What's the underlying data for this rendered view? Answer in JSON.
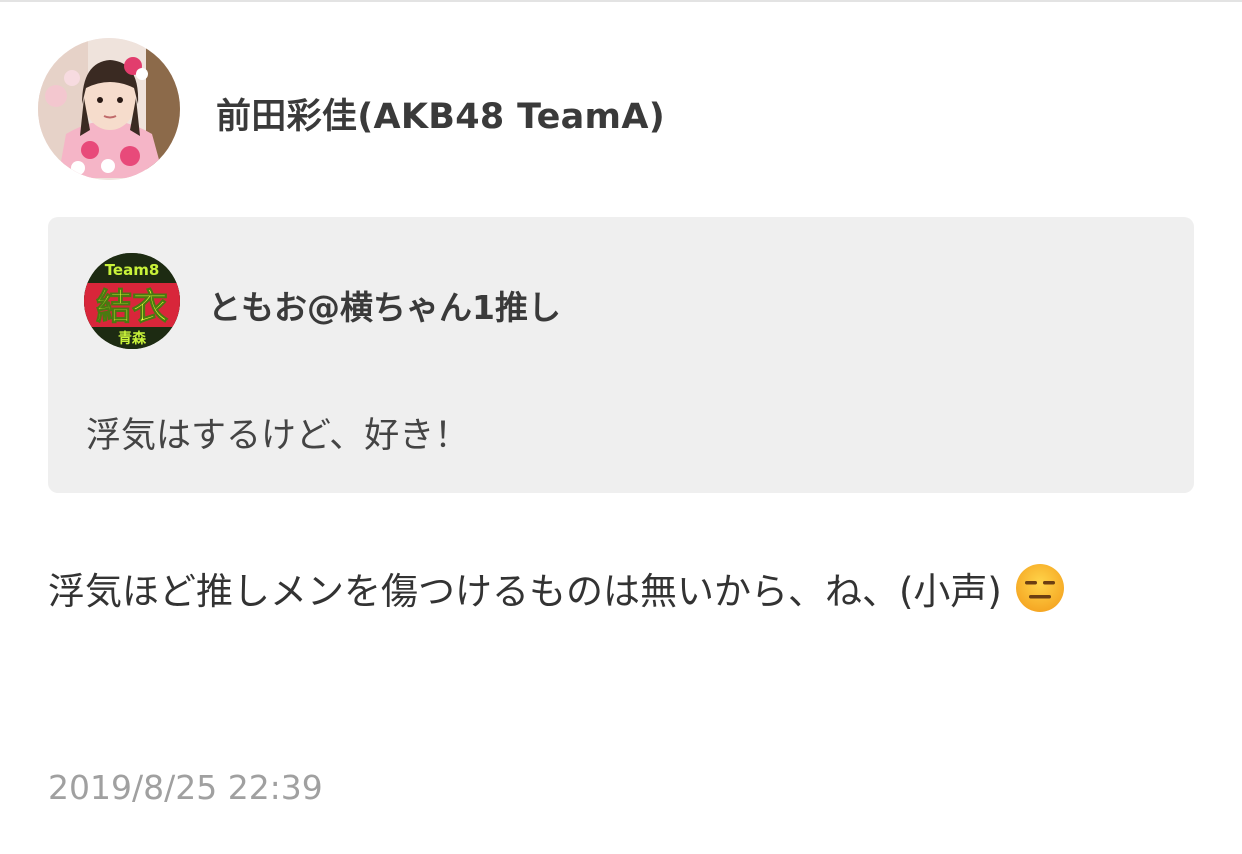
{
  "post": {
    "author_name": "前田彩佳(AKB48 TeamA)",
    "author_avatar_icon": "profile-photo-icon",
    "timestamp": "2019/8/25 22:39"
  },
  "quote": {
    "author_name": "ともお@横ちゃん1推し",
    "avatar_icon": "team8-yui-aomori-icon",
    "avatar_logo_text": [
      "Team8",
      "結衣",
      "青森"
    ],
    "text": "浮気はするけど、好き！"
  },
  "reply": {
    "text": "浮気ほど推しメンを傷つけるものは無いから、ね、(小声)",
    "emoji_icon": "expressionless-face-icon"
  },
  "colors": {
    "quote_background": "#efefef",
    "timestamp": "#a0a0a0",
    "text": "#333333",
    "divider": "#e3e3e3"
  }
}
